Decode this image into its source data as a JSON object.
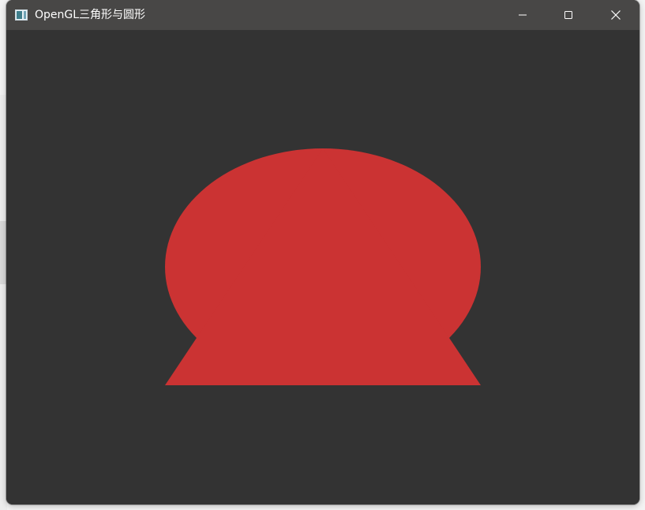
{
  "window": {
    "title": "OpenGL三角形与圆形",
    "controls": {
      "minimize_icon": "minimize-icon",
      "maximize_icon": "maximize-icon",
      "close_icon": "close-icon"
    }
  },
  "canvas": {
    "background_color": "#333333",
    "shape_color": "#cb3333",
    "shapes": [
      "ellipse",
      "triangle"
    ]
  }
}
